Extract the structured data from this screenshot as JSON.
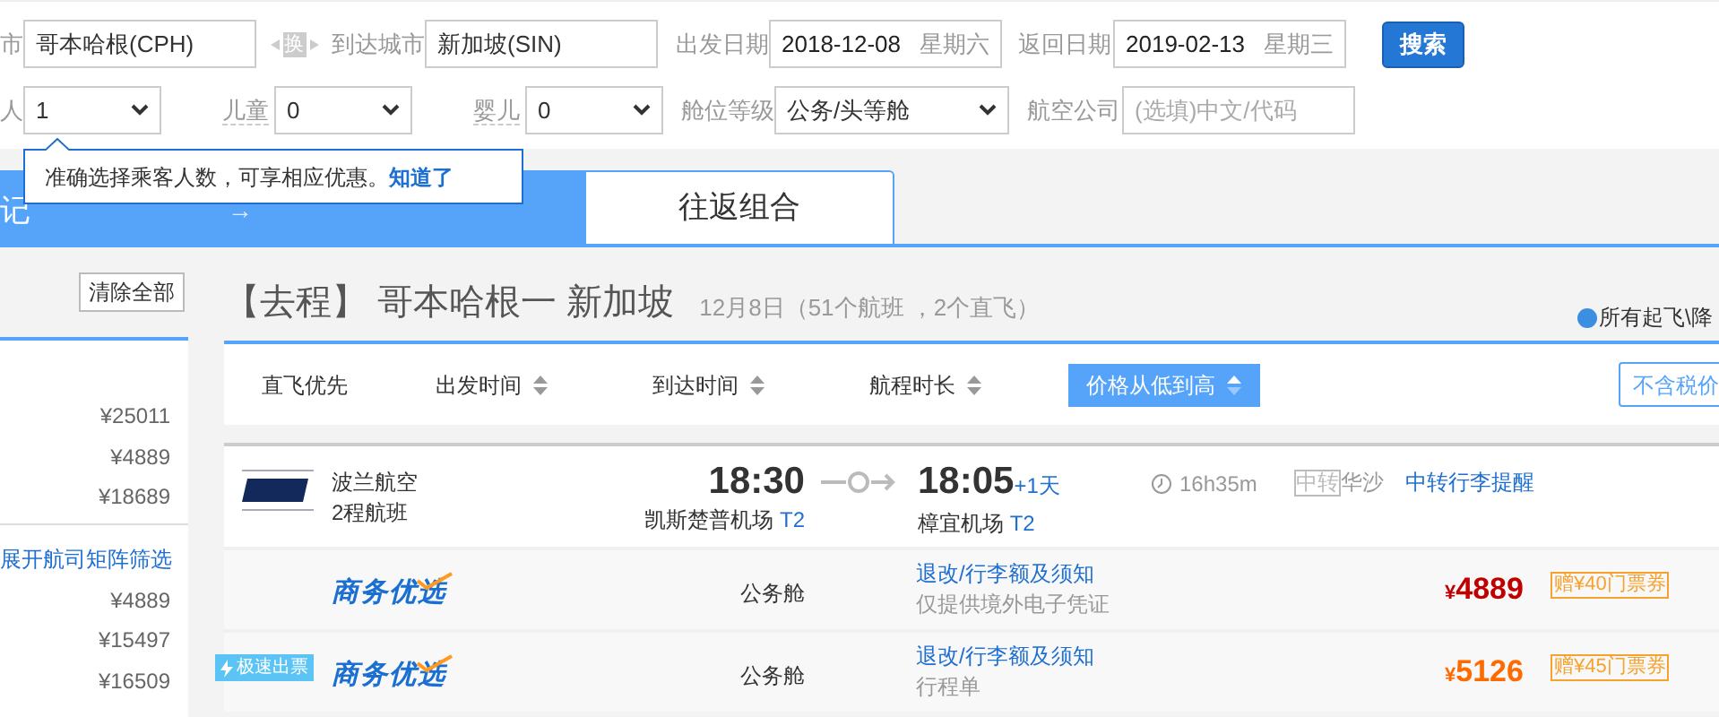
{
  "search": {
    "from_label": "市",
    "from": "哥本哈根(CPH)",
    "swap": "换",
    "to_label": "到达城市",
    "to": "新加坡(SIN)",
    "depart_label": "出发日期",
    "depart_date": "2018-12-08",
    "depart_weekday": "星期六",
    "return_label": "返回日期",
    "return_date": "2019-02-13",
    "return_weekday": "星期三",
    "search_button": "搜索",
    "adults_label": "人",
    "adults": "1",
    "children_label": "儿童",
    "children": "0",
    "infants_label": "婴儿",
    "infants": "0",
    "class_label": "舱位等级",
    "class": "公务/头等舱",
    "airline_label": "航空公司",
    "airline_placeholder": "(选填)中文/代码"
  },
  "tooltip": {
    "text": "准确选择乘客人数，可享相应优惠。",
    "link": "知道了"
  },
  "steps_bar": {
    "title": "记",
    "separator": "→",
    "combo_tab": "往返组合"
  },
  "sidebar": {
    "clear_button": "清除全部",
    "prices_top": [
      "¥25011",
      "¥4889",
      "¥18689"
    ],
    "matrix_link": "展开航司矩阵筛选",
    "prices_bottom": [
      "¥4889",
      "¥15497",
      "¥16509"
    ]
  },
  "results_header": {
    "direction": "【去程】",
    "route": "哥本哈根一 新加坡",
    "summary": "12月8日（51个航班 ，2个直飞）",
    "notice": "所有起飞\\降"
  },
  "sort": [
    {
      "label": "直飞优先",
      "sortable": false,
      "selected": false
    },
    {
      "label": "出发时间",
      "sortable": true,
      "selected": false
    },
    {
      "label": "到达时间",
      "sortable": true,
      "selected": false
    },
    {
      "label": "航程时长",
      "sortable": true,
      "selected": false
    },
    {
      "label": "价格从低到高",
      "sortable": true,
      "selected": true
    }
  ],
  "tax_button": "不含税价",
  "flight": {
    "airline": "波兰航空",
    "segments": "2程航班",
    "depart_time": "18:30",
    "depart_airport": "凯斯楚普机场",
    "depart_terminal": "T2",
    "arrive_time": "18:05",
    "day_offset": "+1天",
    "arrive_airport": "樟宜机场",
    "arrive_terminal": "T2",
    "duration": "16h35m",
    "transfer_tag": "中转",
    "transfer_city": "华沙",
    "baggage_link": "中转行李提醒"
  },
  "fares": [
    {
      "product": "商务优选",
      "cabin": "公务舱",
      "rules_link": "退改/行李额及须知",
      "note": "仅提供境外电子凭证",
      "currency": "¥",
      "price": "4889",
      "color": "#c00000",
      "coupon": "赠¥40门票券"
    },
    {
      "badge": "极速出票",
      "product": "商务优选",
      "cabin": "公务舱",
      "rules_link": "退改/行李额及须知",
      "note": "行程单",
      "currency": "¥",
      "price": "5126",
      "color": "#ff6a00",
      "coupon": "赠¥45门票券"
    }
  ]
}
